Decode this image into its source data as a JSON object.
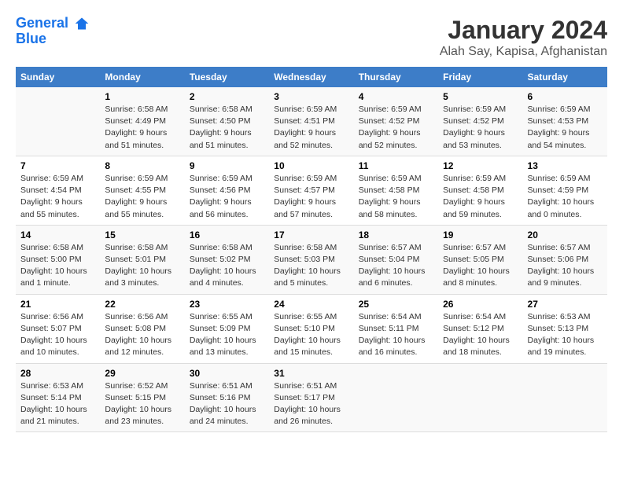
{
  "header": {
    "logo_line1": "General",
    "logo_line2": "Blue",
    "title": "January 2024",
    "subtitle": "Alah Say, Kapisa, Afghanistan"
  },
  "calendar": {
    "days_of_week": [
      "Sunday",
      "Monday",
      "Tuesday",
      "Wednesday",
      "Thursday",
      "Friday",
      "Saturday"
    ],
    "weeks": [
      [
        {
          "num": "",
          "info": ""
        },
        {
          "num": "1",
          "info": "Sunrise: 6:58 AM\nSunset: 4:49 PM\nDaylight: 9 hours\nand 51 minutes."
        },
        {
          "num": "2",
          "info": "Sunrise: 6:58 AM\nSunset: 4:50 PM\nDaylight: 9 hours\nand 51 minutes."
        },
        {
          "num": "3",
          "info": "Sunrise: 6:59 AM\nSunset: 4:51 PM\nDaylight: 9 hours\nand 52 minutes."
        },
        {
          "num": "4",
          "info": "Sunrise: 6:59 AM\nSunset: 4:52 PM\nDaylight: 9 hours\nand 52 minutes."
        },
        {
          "num": "5",
          "info": "Sunrise: 6:59 AM\nSunset: 4:52 PM\nDaylight: 9 hours\nand 53 minutes."
        },
        {
          "num": "6",
          "info": "Sunrise: 6:59 AM\nSunset: 4:53 PM\nDaylight: 9 hours\nand 54 minutes."
        }
      ],
      [
        {
          "num": "7",
          "info": "Sunrise: 6:59 AM\nSunset: 4:54 PM\nDaylight: 9 hours\nand 55 minutes."
        },
        {
          "num": "8",
          "info": "Sunrise: 6:59 AM\nSunset: 4:55 PM\nDaylight: 9 hours\nand 55 minutes."
        },
        {
          "num": "9",
          "info": "Sunrise: 6:59 AM\nSunset: 4:56 PM\nDaylight: 9 hours\nand 56 minutes."
        },
        {
          "num": "10",
          "info": "Sunrise: 6:59 AM\nSunset: 4:57 PM\nDaylight: 9 hours\nand 57 minutes."
        },
        {
          "num": "11",
          "info": "Sunrise: 6:59 AM\nSunset: 4:58 PM\nDaylight: 9 hours\nand 58 minutes."
        },
        {
          "num": "12",
          "info": "Sunrise: 6:59 AM\nSunset: 4:58 PM\nDaylight: 9 hours\nand 59 minutes."
        },
        {
          "num": "13",
          "info": "Sunrise: 6:59 AM\nSunset: 4:59 PM\nDaylight: 10 hours\nand 0 minutes."
        }
      ],
      [
        {
          "num": "14",
          "info": "Sunrise: 6:58 AM\nSunset: 5:00 PM\nDaylight: 10 hours\nand 1 minute."
        },
        {
          "num": "15",
          "info": "Sunrise: 6:58 AM\nSunset: 5:01 PM\nDaylight: 10 hours\nand 3 minutes."
        },
        {
          "num": "16",
          "info": "Sunrise: 6:58 AM\nSunset: 5:02 PM\nDaylight: 10 hours\nand 4 minutes."
        },
        {
          "num": "17",
          "info": "Sunrise: 6:58 AM\nSunset: 5:03 PM\nDaylight: 10 hours\nand 5 minutes."
        },
        {
          "num": "18",
          "info": "Sunrise: 6:57 AM\nSunset: 5:04 PM\nDaylight: 10 hours\nand 6 minutes."
        },
        {
          "num": "19",
          "info": "Sunrise: 6:57 AM\nSunset: 5:05 PM\nDaylight: 10 hours\nand 8 minutes."
        },
        {
          "num": "20",
          "info": "Sunrise: 6:57 AM\nSunset: 5:06 PM\nDaylight: 10 hours\nand 9 minutes."
        }
      ],
      [
        {
          "num": "21",
          "info": "Sunrise: 6:56 AM\nSunset: 5:07 PM\nDaylight: 10 hours\nand 10 minutes."
        },
        {
          "num": "22",
          "info": "Sunrise: 6:56 AM\nSunset: 5:08 PM\nDaylight: 10 hours\nand 12 minutes."
        },
        {
          "num": "23",
          "info": "Sunrise: 6:55 AM\nSunset: 5:09 PM\nDaylight: 10 hours\nand 13 minutes."
        },
        {
          "num": "24",
          "info": "Sunrise: 6:55 AM\nSunset: 5:10 PM\nDaylight: 10 hours\nand 15 minutes."
        },
        {
          "num": "25",
          "info": "Sunrise: 6:54 AM\nSunset: 5:11 PM\nDaylight: 10 hours\nand 16 minutes."
        },
        {
          "num": "26",
          "info": "Sunrise: 6:54 AM\nSunset: 5:12 PM\nDaylight: 10 hours\nand 18 minutes."
        },
        {
          "num": "27",
          "info": "Sunrise: 6:53 AM\nSunset: 5:13 PM\nDaylight: 10 hours\nand 19 minutes."
        }
      ],
      [
        {
          "num": "28",
          "info": "Sunrise: 6:53 AM\nSunset: 5:14 PM\nDaylight: 10 hours\nand 21 minutes."
        },
        {
          "num": "29",
          "info": "Sunrise: 6:52 AM\nSunset: 5:15 PM\nDaylight: 10 hours\nand 23 minutes."
        },
        {
          "num": "30",
          "info": "Sunrise: 6:51 AM\nSunset: 5:16 PM\nDaylight: 10 hours\nand 24 minutes."
        },
        {
          "num": "31",
          "info": "Sunrise: 6:51 AM\nSunset: 5:17 PM\nDaylight: 10 hours\nand 26 minutes."
        },
        {
          "num": "",
          "info": ""
        },
        {
          "num": "",
          "info": ""
        },
        {
          "num": "",
          "info": ""
        }
      ]
    ]
  }
}
